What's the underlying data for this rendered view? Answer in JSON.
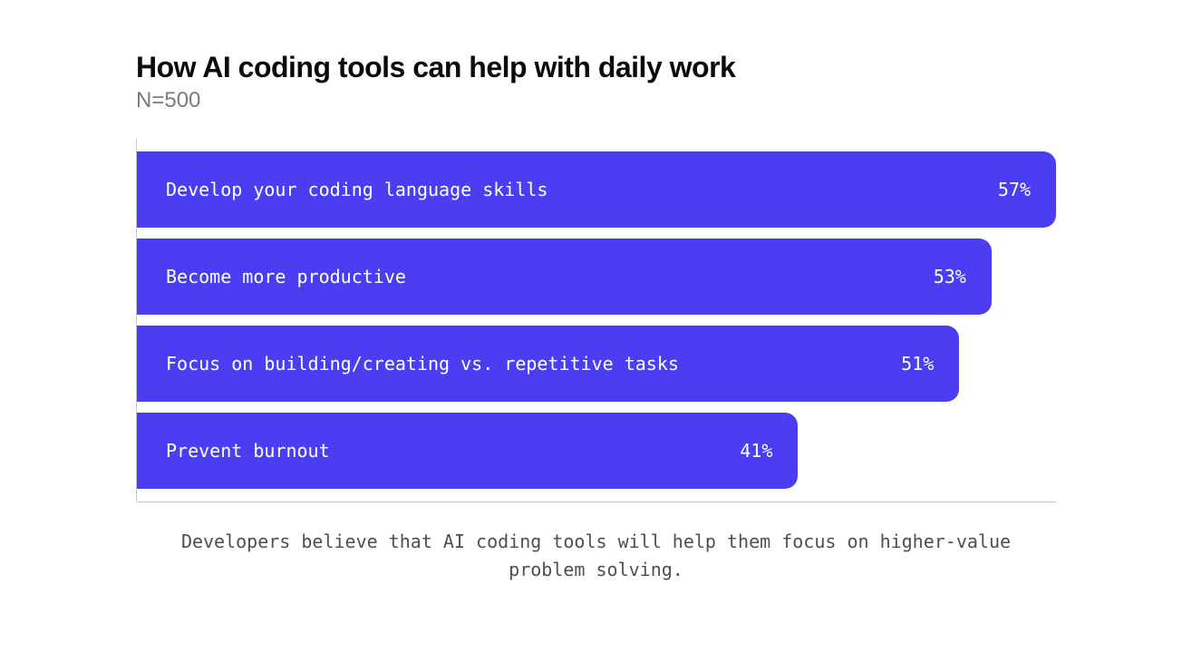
{
  "header": {
    "title": "How AI coding tools can help with daily work",
    "subtitle": "N=500"
  },
  "caption": "Developers believe that AI coding tools will help them focus on higher-value problem solving.",
  "chart_data": {
    "type": "bar",
    "orientation": "horizontal",
    "title": "How AI coding tools can help with daily work",
    "xlabel": "",
    "ylabel": "",
    "xlim": [
      0,
      57
    ],
    "categories": [
      "Develop your coding language skills",
      "Become more productive",
      "Focus on building/creating vs. repetitive tasks",
      "Prevent burnout"
    ],
    "values": [
      57,
      53,
      51,
      41
    ],
    "value_labels": [
      "57%",
      "53%",
      "51%",
      "41%"
    ],
    "bar_color": "#4a3df2"
  }
}
